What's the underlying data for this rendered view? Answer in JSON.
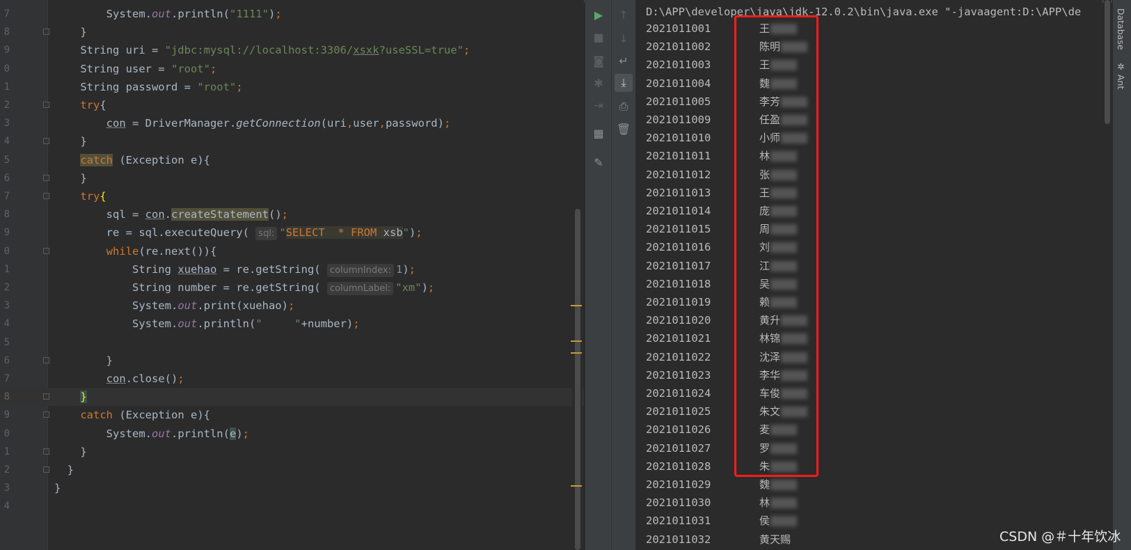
{
  "editor": {
    "lines": [
      {
        "n": "7",
        "html": "        System.<span class='ital'>out</span>.println(<span class='str'>\"1111\"</span>)<span class='kw'>;</span>"
      },
      {
        "n": "8",
        "html": "    }",
        "fold": true
      },
      {
        "n": "9",
        "html": "    String uri = <span class='str'>\"jdbc:mysql://localhost:3306/<span class='ul'>xsxk</span>?useSSL=true\"</span><span class='kw'>;</span>"
      },
      {
        "n": "0",
        "html": "    String user = <span class='str'>\"root\"</span><span class='kw'>;</span>"
      },
      {
        "n": "1",
        "html": "    String password = <span class='str'>\"root\"</span><span class='kw'>;</span>"
      },
      {
        "n": "2",
        "html": "    <span class='kw'>try</span>{",
        "fold": true
      },
      {
        "n": "3",
        "html": "        <span class='ul'>con</span> = DriverManager.<span class='fn-ital'>getConnection</span>(uri<span class='kw'>,</span>user<span class='kw'>,</span>password)<span class='kw'>;</span>"
      },
      {
        "n": "4",
        "html": "    }",
        "fold": true
      },
      {
        "n": "5",
        "html": "    <span class='kw hl2'>catch</span> (Exception e){"
      },
      {
        "n": "6",
        "html": "    }",
        "fold": true
      },
      {
        "n": "7",
        "html": "    <span class='kw'>try</span><span class='yellow'>{</span>",
        "fold": true
      },
      {
        "n": "8",
        "html": "        sql = <span class='ul'>con</span>.<span class='hl2'>createStatement</span>()<span class='kw'>;</span>"
      },
      {
        "n": "9",
        "html": "        re = sql.executeQuery( <span class='hint'>sql:</span><span class='str'>\"</span><span class='sqlfrag'>SELECT  * FROM </span><span class='sqlfrag' style='color:#a9b7c6'>xsb</span><span class='str'>\"</span>)<span class='kw'>;</span>"
      },
      {
        "n": "0",
        "html": "        <span class='kw'>while</span>(re.next()){",
        "fold": true
      },
      {
        "n": "1",
        "html": "            String <span class='ul'>xuehao</span> = re.getString( <span class='hint'>columnIndex:</span><span class='num'>1</span>)<span class='kw'>;</span>"
      },
      {
        "n": "2",
        "html": "            String number = re.getString( <span class='hint'>columnLabel:</span><span class='str'>\"xm\"</span>)<span class='kw'>;</span>"
      },
      {
        "n": "3",
        "html": "            System.<span class='ital'>out</span>.print(xuehao)<span class='kw'>;</span>"
      },
      {
        "n": "4",
        "html": "            System.<span class='ital'>out</span>.println(<span class='str'>\"     \"</span>+number)<span class='kw'>;</span>"
      },
      {
        "n": "5",
        "html": ""
      },
      {
        "n": "6",
        "html": "        }",
        "fold": true
      },
      {
        "n": "7",
        "html": "        <span class='ul'>con</span>.close()<span class='kw'>;</span>"
      },
      {
        "n": "8",
        "html": "    <span class='yellow hl'>}</span>",
        "fold": true,
        "current": true
      },
      {
        "n": "9",
        "html": "    <span class='kw'>catch</span> (Exception e){",
        "fold": true
      },
      {
        "n": "0",
        "html": "        System.<span class='ital'>out</span>.println(<span class='hl'>e</span>)<span class='kw'>;</span>"
      },
      {
        "n": "1",
        "html": "    }",
        "fold": true
      },
      {
        "n": "2",
        "html": "  }",
        "fold": true
      },
      {
        "n": "3",
        "html": "}"
      },
      {
        "n": "4",
        "html": ""
      }
    ]
  },
  "console": {
    "command": "D:\\APP\\developer\\java\\jdk-12.0.2\\bin\\java.exe \"-javaagent:D:\\APP\\de",
    "rows": [
      {
        "id": "2021011001",
        "name": "王"
      },
      {
        "id": "2021011002",
        "name": "陈明"
      },
      {
        "id": "2021011003",
        "name": "王"
      },
      {
        "id": "2021011004",
        "name": "魏"
      },
      {
        "id": "2021011005",
        "name": "李芳"
      },
      {
        "id": "2021011009",
        "name": "任盈"
      },
      {
        "id": "2021011010",
        "name": "小师"
      },
      {
        "id": "2021011011",
        "name": "林"
      },
      {
        "id": "2021011012",
        "name": "张"
      },
      {
        "id": "2021011013",
        "name": "王"
      },
      {
        "id": "2021011014",
        "name": "庞"
      },
      {
        "id": "2021011015",
        "name": "周"
      },
      {
        "id": "2021011016",
        "name": "刘"
      },
      {
        "id": "2021011017",
        "name": "江"
      },
      {
        "id": "2021011018",
        "name": "吴"
      },
      {
        "id": "2021011019",
        "name": "赖"
      },
      {
        "id": "2021011020",
        "name": "黄升"
      },
      {
        "id": "2021011021",
        "name": "林锦"
      },
      {
        "id": "2021011022",
        "name": "沈泽"
      },
      {
        "id": "2021011023",
        "name": "李华"
      },
      {
        "id": "2021011024",
        "name": "车俊"
      },
      {
        "id": "2021011025",
        "name": "朱文"
      },
      {
        "id": "2021011026",
        "name": "麦"
      },
      {
        "id": "2021011027",
        "name": "罗"
      },
      {
        "id": "2021011028",
        "name": "朱"
      },
      {
        "id": "2021011029",
        "name": "魏"
      },
      {
        "id": "2021011030",
        "name": "林"
      },
      {
        "id": "2021011031",
        "name": "侯"
      },
      {
        "id": "2021011032",
        "name": "黄天赐"
      }
    ]
  },
  "sidebar_tabs": [
    "Database",
    "Ant"
  ],
  "watermark": "CSDN @＃十年饮冰",
  "colors": {
    "highlight_box": "#ff1c1c",
    "run_green": "#59a869",
    "keyword": "#cc7832",
    "string": "#6a8759"
  }
}
